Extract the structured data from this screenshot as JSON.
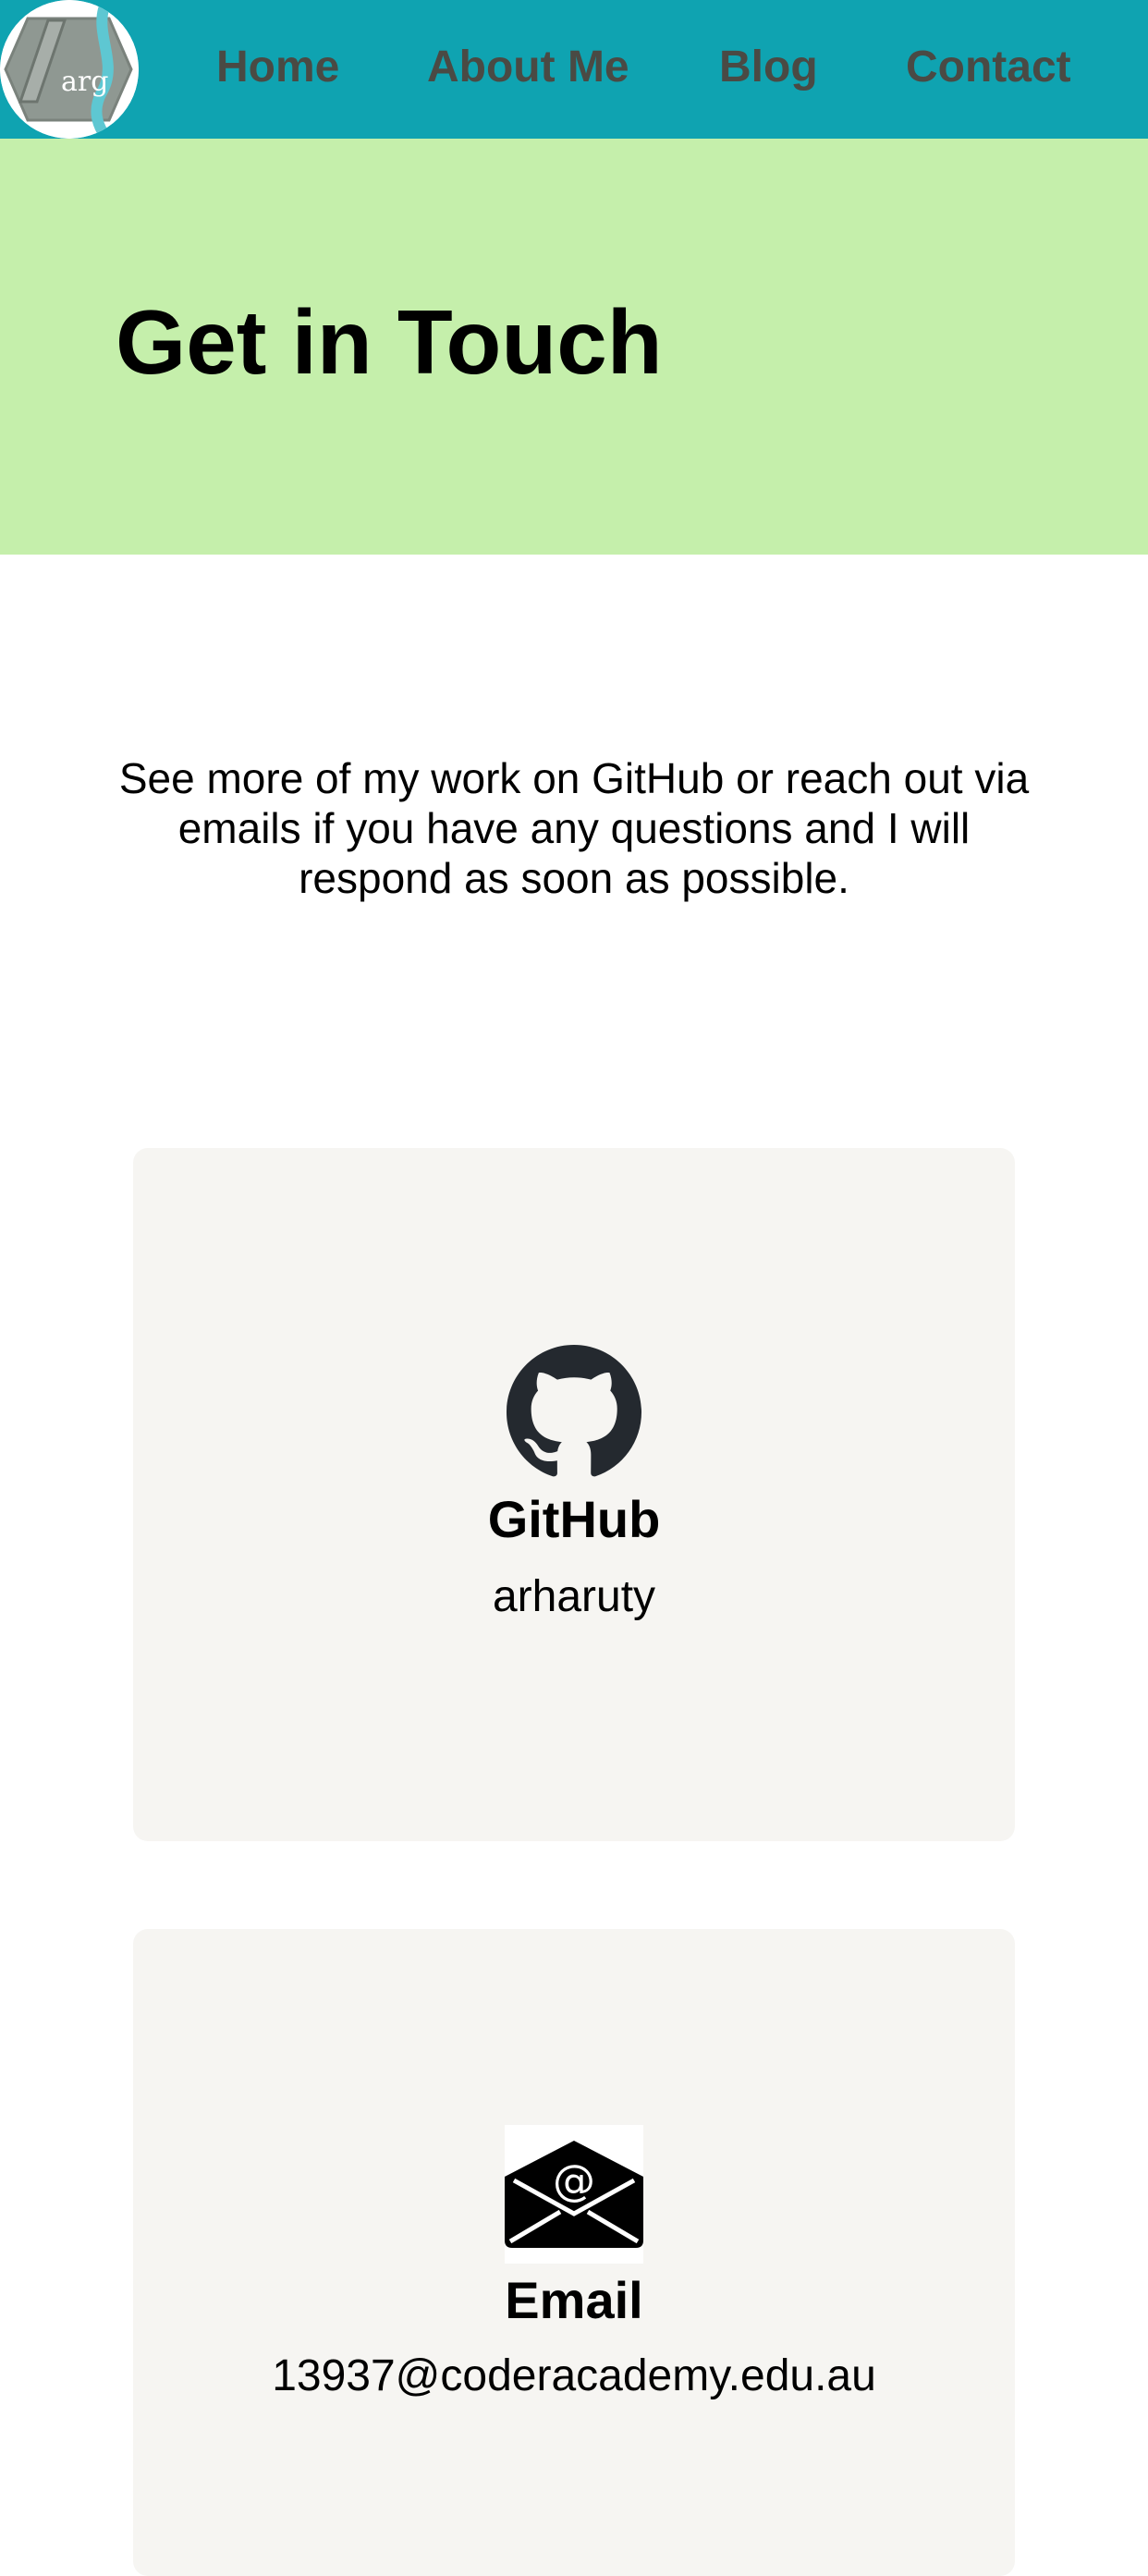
{
  "logo": {
    "text": "arg"
  },
  "nav": {
    "home": "Home",
    "about": "About Me",
    "blog": "Blog",
    "contact": "Contact"
  },
  "hero": {
    "title": "Get in Touch"
  },
  "intro": {
    "text": "See more of my work on GitHub or reach out via emails if you have any questions and I will respond as soon as possible."
  },
  "contacts": {
    "github": {
      "icon": "github-icon",
      "heading": "GitHub",
      "value": "arharuty"
    },
    "email": {
      "icon": "email-envelope-icon",
      "heading": "Email",
      "value": "13937@coderacademy.edu.au"
    }
  },
  "colors": {
    "navbar": "#0fa3b1",
    "nav_text": "#4a4a44",
    "hero": "#c5efab",
    "card": "#f6f5f2"
  }
}
